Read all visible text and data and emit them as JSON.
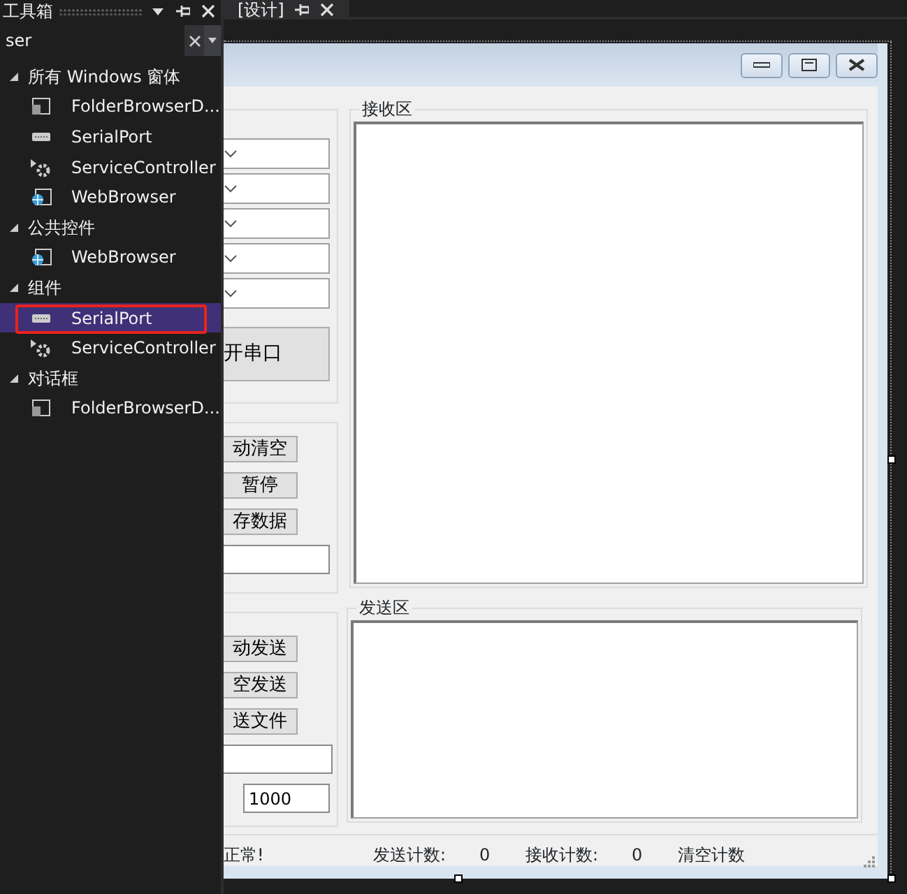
{
  "toolbox": {
    "title": "工具箱",
    "search": {
      "value": "ser"
    },
    "categories": [
      {
        "label": "所有 Windows 窗体",
        "expanded": true,
        "children": [
          {
            "label": "FolderBrowserD...",
            "kind": "dialog",
            "selected": false,
            "annotated": false
          },
          {
            "label": "SerialPort",
            "kind": "port",
            "selected": false,
            "annotated": false
          },
          {
            "label": "ServiceController",
            "kind": "service",
            "selected": false,
            "annotated": false
          },
          {
            "label": "WebBrowser",
            "kind": "browser",
            "selected": false,
            "annotated": false
          }
        ]
      },
      {
        "label": "公共控件",
        "expanded": true,
        "children": [
          {
            "label": "WebBrowser",
            "kind": "browser",
            "selected": false,
            "annotated": false
          }
        ]
      },
      {
        "label": "组件",
        "expanded": true,
        "children": [
          {
            "label": "SerialPort",
            "kind": "port",
            "selected": true,
            "annotated": true
          },
          {
            "label": "ServiceController",
            "kind": "service",
            "selected": false,
            "annotated": false
          }
        ]
      },
      {
        "label": "对话框",
        "expanded": true,
        "children": [
          {
            "label": "FolderBrowserD...",
            "kind": "dialog",
            "selected": false,
            "annotated": false
          }
        ]
      }
    ]
  },
  "designer": {
    "tab": {
      "label": "[设计]"
    },
    "form": {
      "left_groups": [
        {
          "controls": [
            {
              "kind": "combo"
            },
            {
              "kind": "combo"
            },
            {
              "kind": "combo"
            },
            {
              "kind": "combo"
            },
            {
              "kind": "combo"
            },
            {
              "kind": "big-button",
              "label": "开串口"
            }
          ]
        },
        {
          "controls": [
            {
              "kind": "button",
              "label": "动清空"
            },
            {
              "kind": "button",
              "label": "暂停"
            },
            {
              "kind": "button",
              "label": "存数据"
            },
            {
              "kind": "textbox"
            }
          ]
        },
        {
          "controls": [
            {
              "kind": "button",
              "label": "动发送"
            },
            {
              "kind": "button",
              "label": "空发送"
            },
            {
              "kind": "button",
              "label": "送文件"
            },
            {
              "kind": "textbox"
            },
            {
              "kind": "small-textbox",
              "value": "1000"
            }
          ]
        }
      ],
      "receive_group": {
        "title": "接收区"
      },
      "send_group": {
        "title": "发送区"
      },
      "status": [
        {
          "text": "正常!"
        },
        {
          "text": "发送计数:"
        },
        {
          "text": "0"
        },
        {
          "text": "接收计数:"
        },
        {
          "text": "0"
        },
        {
          "text": "清空计数"
        }
      ]
    }
  }
}
